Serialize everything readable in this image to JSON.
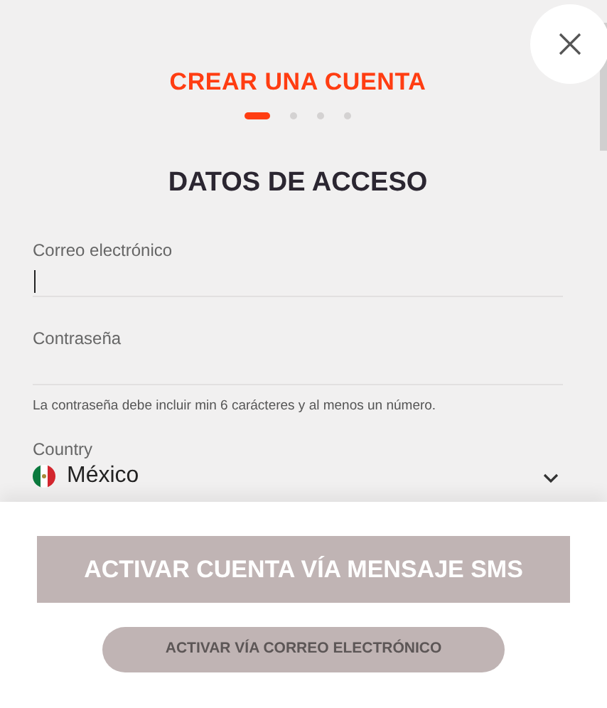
{
  "header": {
    "title": "CREAR UNA CUENTA"
  },
  "steps": [
    {
      "selected": true
    },
    {
      "selected": false
    },
    {
      "selected": false
    },
    {
      "selected": false
    }
  ],
  "section_title": "DATOS DE ACCESO",
  "fields": [
    {
      "label": "Correo electrónico",
      "focused": true
    },
    {
      "label": "Contraseña",
      "focused": false,
      "hint": "La contraseña debe incluir min 6 carácteres y al menos un número."
    }
  ],
  "country": {
    "label": "Country",
    "value": "México"
  },
  "buttons": [
    {
      "kind": "primary",
      "label": "ACTIVAR CUENTA VÍA MENSAJE SMS"
    },
    {
      "kind": "secondary",
      "label": "ACTIVAR VÍA CORREO ELECTRÓNICO"
    }
  ]
}
